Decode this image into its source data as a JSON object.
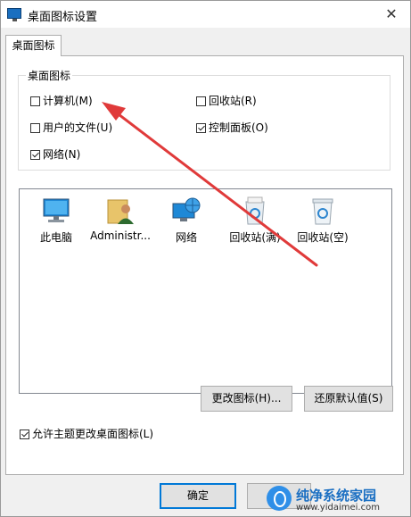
{
  "window": {
    "title": "桌面图标设置",
    "close_glyph": "✕"
  },
  "tabs": [
    {
      "label": "桌面图标"
    }
  ],
  "group": {
    "label": "桌面图标",
    "checkboxes": [
      {
        "label": "计算机(M)",
        "checked": false
      },
      {
        "label": "回收站(R)",
        "checked": false
      },
      {
        "label": "用户的文件(U)",
        "checked": false
      },
      {
        "label": "控制面板(O)",
        "checked": true
      },
      {
        "label": "网络(N)",
        "checked": true
      }
    ]
  },
  "icon_list": [
    {
      "label": "此电脑",
      "icon": "computer-icon"
    },
    {
      "label": "Administr...",
      "icon": "user-folder-icon"
    },
    {
      "label": "网络",
      "icon": "network-icon"
    },
    {
      "label": "回收站(满)",
      "icon": "recycle-bin-full-icon"
    },
    {
      "label": "回收站(空)",
      "icon": "recycle-bin-empty-icon"
    }
  ],
  "buttons": {
    "change_icon": "更改图标(H)...",
    "restore_default": "还原默认值(S)",
    "ok": "确定",
    "cancel": "取"
  },
  "theme_checkbox": {
    "label": "允许主题更改桌面图标(L)",
    "checked": true
  },
  "watermark": {
    "title": "纯净系统家园",
    "url": "www.yidaimei.com"
  },
  "colors": {
    "accent": "#0078d7",
    "arrow": "#e03a3a"
  }
}
